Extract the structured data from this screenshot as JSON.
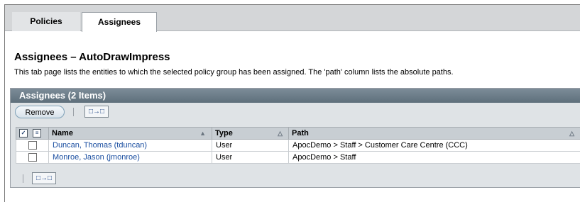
{
  "tabs": [
    {
      "label": "Policies",
      "active": false
    },
    {
      "label": "Assignees",
      "active": true
    }
  ],
  "page": {
    "title": "Assignees – AutoDrawImpress",
    "description": "This tab page lists the entities to which the selected policy group has been assigned. The 'path' column lists the absolute paths."
  },
  "table": {
    "title": "Assignees (2 Items)",
    "remove_label": "Remove",
    "columns": [
      "Name",
      "Type",
      "Path"
    ],
    "rows": [
      {
        "name": "Duncan, Thomas (tduncan)",
        "type": "User",
        "path": "ApocDemo > Staff > Customer Care Centre (CCC)"
      },
      {
        "name": "Monroe, Jason (jmonroe)",
        "type": "User",
        "path": "ApocDemo > Staff"
      }
    ]
  },
  "icons": {
    "select_all": "select-all-icon",
    "deselect_all": "deselect-all-icon",
    "sort_ascending": "sort-ascending-icon",
    "pagination": "pagination-icon"
  },
  "colors": {
    "title_bar": "#5e6f7b",
    "link": "#1a4ea0",
    "tab_bar": "#d4d6d8"
  }
}
